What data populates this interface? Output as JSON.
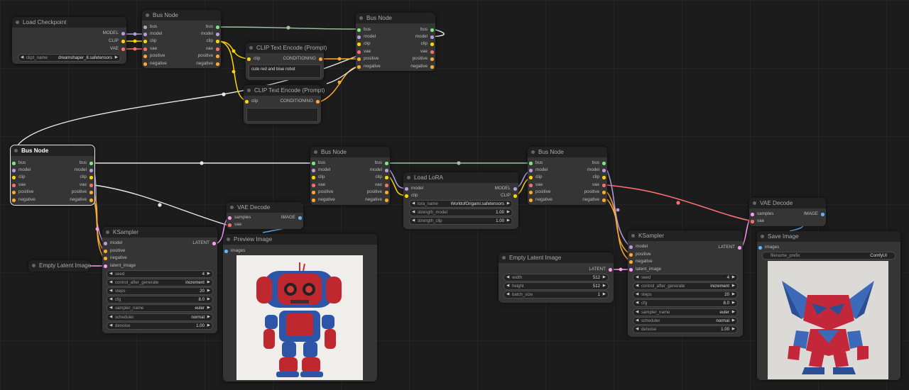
{
  "colors": {
    "bus": "#e8e8e8",
    "model": "#b39ddb",
    "clip": "#ffd500",
    "vae": "#ff6e6e",
    "conditioning": "#ffa931",
    "latent": "#ff9cf9",
    "image": "#64b5f6",
    "int": "#7ee77e"
  },
  "bus_node_1": {
    "title": "Bus Node",
    "in": [
      "bus",
      "model",
      "clip",
      "vae",
      "positive",
      "negative"
    ],
    "out": [
      "bus",
      "model",
      "clip",
      "vae",
      "positive",
      "negative"
    ]
  },
  "bus_node_2": {
    "title": "Bus Node",
    "in": [
      "bus",
      "model",
      "clip",
      "vae",
      "positive",
      "negative"
    ],
    "out": [
      "bus",
      "model",
      "clip",
      "vae",
      "positive",
      "negative"
    ]
  },
  "bus_node_3": {
    "title": "Bus Node",
    "in": [
      "bus",
      "model",
      "clip",
      "vae",
      "positive",
      "negative"
    ],
    "out": [
      "bus",
      "model",
      "clip",
      "vae",
      "positive",
      "negative"
    ]
  },
  "bus_node_4": {
    "title": "Bus Node",
    "in": [
      "bus",
      "model",
      "clip",
      "vae",
      "positive",
      "negative"
    ],
    "out": [
      "bus",
      "model",
      "clip",
      "vae",
      "positive",
      "negative"
    ]
  },
  "bus_node_5": {
    "title": "Bus Node",
    "in": [
      "bus",
      "model",
      "clip",
      "vae",
      "positive",
      "negative"
    ],
    "out": [
      "bus",
      "model",
      "clip",
      "vae",
      "positive",
      "negative"
    ]
  },
  "load_checkpoint": {
    "title": "Load Checkpoint",
    "out": [
      "MODEL",
      "CLIP",
      "VAE"
    ],
    "widget_label": "ckpt_name",
    "widget_value": "dreamshaper_8.safetensors"
  },
  "clip_encode_1": {
    "title": "CLIP Text Encode (Prompt)",
    "in": "clip",
    "out": "CONDITIONING",
    "text": "cute red and blue robot"
  },
  "clip_encode_2": {
    "title": "CLIP Text Encode (Prompt)",
    "in": "clip",
    "out": "CONDITIONING",
    "text": ""
  },
  "load_lora": {
    "title": "Load LoRA",
    "in": [
      "model",
      "clip"
    ],
    "out": [
      "MODEL",
      "CLIP"
    ],
    "widgets": [
      {
        "label": "lora_name",
        "value": "WorldofOrigami.safetensors"
      },
      {
        "label": "strength_model",
        "value": "1.00"
      },
      {
        "label": "strength_clip",
        "value": "1.00"
      }
    ]
  },
  "empty_latent_1": {
    "title": "Empty Latent Image"
  },
  "empty_latent_2": {
    "title": "Empty Latent Image",
    "out": "LATENT",
    "widgets": [
      {
        "label": "width",
        "value": "512"
      },
      {
        "label": "height",
        "value": "512"
      },
      {
        "label": "batch_size",
        "value": "1"
      }
    ]
  },
  "ksampler_1": {
    "title": "KSampler",
    "in": [
      "model",
      "positive",
      "negative",
      "latent_image"
    ],
    "out": "LATENT",
    "widgets": [
      {
        "label": "seed",
        "value": "4"
      },
      {
        "label": "control_after_generate",
        "value": "increment"
      },
      {
        "label": "steps",
        "value": "20"
      },
      {
        "label": "cfg",
        "value": "8.0"
      },
      {
        "label": "sampler_name",
        "value": "euler"
      },
      {
        "label": "scheduler",
        "value": "normal"
      },
      {
        "label": "denoise",
        "value": "1.00"
      }
    ]
  },
  "ksampler_2": {
    "title": "KSampler",
    "in": [
      "model",
      "positive",
      "negative",
      "latent_image"
    ],
    "out": "LATENT",
    "widgets": [
      {
        "label": "seed",
        "value": "4"
      },
      {
        "label": "control_after_generate",
        "value": "increment"
      },
      {
        "label": "steps",
        "value": "20"
      },
      {
        "label": "cfg",
        "value": "8.0"
      },
      {
        "label": "sampler_name",
        "value": "euler"
      },
      {
        "label": "scheduler",
        "value": "normal"
      },
      {
        "label": "denoise",
        "value": "1.00"
      }
    ]
  },
  "vae_decode_1": {
    "title": "VAE Decode",
    "in": [
      "samples",
      "vae"
    ],
    "out": "IMAGE"
  },
  "vae_decode_2": {
    "title": "VAE Decode",
    "in": [
      "samples",
      "vae"
    ],
    "out": "IMAGE"
  },
  "preview_image": {
    "title": "Preview Image",
    "in": "images"
  },
  "save_image": {
    "title": "Save Image",
    "in": "images",
    "widget_label": "filename_prefix",
    "widget_value": "ComfyUI"
  }
}
